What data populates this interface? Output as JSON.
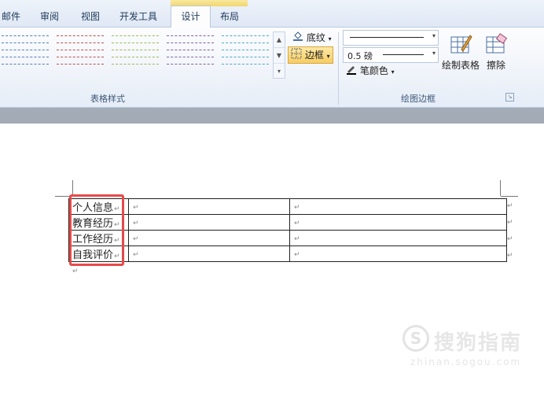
{
  "tabs": {
    "mail": "邮件",
    "review": "审阅",
    "view": "视图",
    "developer": "开发工具",
    "design": "设计",
    "layout": "布局"
  },
  "ribbon": {
    "table_styles_label": "表格样式",
    "shading_label": "底纹",
    "borders_label": "边框",
    "line_weight": "0.5 磅",
    "pen_color_label": "笔颜色",
    "draw_table_label": "绘制表格",
    "eraser_label": "擦除",
    "draw_borders_label": "绘图边框"
  },
  "style_colors": [
    "#4f81bd",
    "#c0504d",
    "#9bbb59",
    "#8064a2",
    "#4bacc6"
  ],
  "table": {
    "rows": [
      "个人信息",
      "教育经历",
      "工作经历",
      "自我评价"
    ]
  },
  "paragraph_mark": "↵",
  "watermark": {
    "text": "搜狗指南",
    "url": "zhinan.sogou.com"
  }
}
